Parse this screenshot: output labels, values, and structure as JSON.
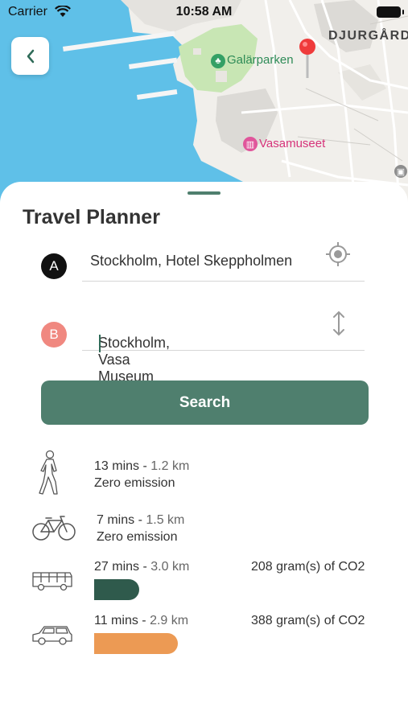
{
  "status_bar": {
    "carrier": "Carrier",
    "time": "10:58 AM"
  },
  "map": {
    "park_label": "Galärparken",
    "museum_label": "Vasamuseet",
    "district_label": "DJURGÅRDE"
  },
  "planner": {
    "title": "Travel Planner",
    "origin_badge": "A",
    "destination_badge": "B",
    "origin_value": "Stockholm, Hotel Skeppholmen",
    "destination_value": "Stockholm, Vasa Museum",
    "search_label": "Search"
  },
  "options": {
    "walk": {
      "time": "13 mins",
      "sep": " - ",
      "distance": "1.2 km",
      "emission": "Zero emission",
      "icon": "walking-person-icon"
    },
    "bike": {
      "time": "7 mins",
      "sep": " - ",
      "distance": "1.5 km",
      "emission": "Zero emission",
      "icon": "bicycle-icon"
    },
    "bus": {
      "time": "27 mins",
      "sep": " - ",
      "distance": "3.0 km",
      "emission": "208 gram(s) of CO2",
      "icon": "bus-icon",
      "bar_color": "#2f5a4c",
      "co2_grams": 208
    },
    "car": {
      "time": "11 mins",
      "sep": " - ",
      "distance": "2.9 km",
      "emission": "388 gram(s) of CO2",
      "icon": "car-icon",
      "bar_color": "#ec9a54",
      "co2_grams": 388
    }
  },
  "colors": {
    "accent": "#4f7f6e",
    "badge_a": "#111111",
    "badge_b": "#f08880",
    "water": "#5fc0e8",
    "park": "#c8e6b4"
  }
}
